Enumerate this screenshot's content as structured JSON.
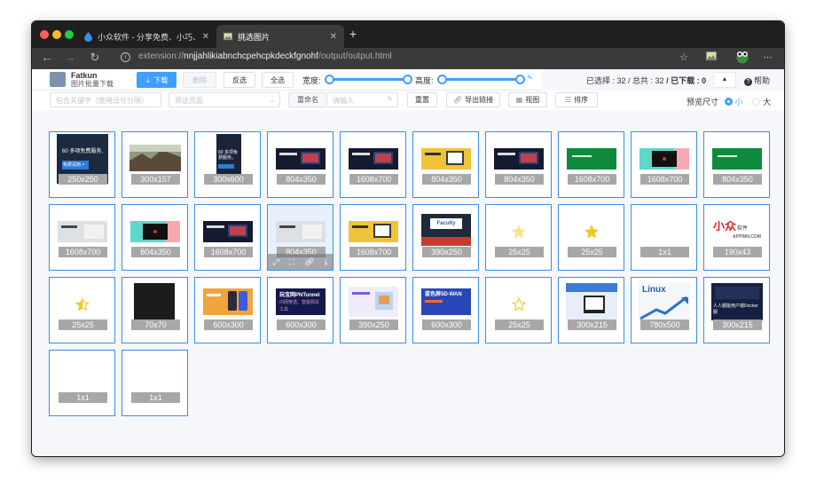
{
  "browser": {
    "tabs": [
      {
        "title": "小众软件 - 分享免费、小巧、实用",
        "favicon": "drop-icon",
        "active": false
      },
      {
        "title": "挑选图片",
        "favicon": "image-icon",
        "active": true
      }
    ],
    "url_prefix": "extension://",
    "url_host": "nnjjahlikiabnchcpehcpkdeckfgnohf",
    "url_path": "/output/output.html"
  },
  "app": {
    "brand_title": "Fatkun",
    "brand_subtitle": "图片批量下载",
    "download_label": "下载",
    "clear_label": "删除",
    "invert_label": "反选",
    "select_all_label": "全选",
    "width_label": "宽度:",
    "height_label": "高度:",
    "width_range_fraction": [
      0.0,
      1.0
    ],
    "height_range_fraction": [
      0.0,
      1.0
    ],
    "selected_label": "已选择 : ",
    "selected_count": "32",
    "total_label": " / 总共 : ",
    "total_count": "32",
    "downloaded_label": " / 已下载 : ",
    "downloaded_count": "0",
    "help_label": "帮助"
  },
  "filters": {
    "keyword_placeholder": "包含关键字（使用逗号分隔）",
    "page_select_placeholder": "筛选页面",
    "rename_label": "重命名",
    "rename_placeholder": "请输入",
    "reset_label": "重置",
    "export_label": "导出链接",
    "view_label": "视图",
    "sort_label": "排序",
    "preview_label": "预览尺寸",
    "size_small": "小",
    "size_large": "大"
  },
  "images": [
    {
      "dim": "250x250",
      "kind": "ad-dark"
    },
    {
      "dim": "300x157",
      "kind": "photo"
    },
    {
      "dim": "300x600",
      "kind": "ad-tall"
    },
    {
      "dim": "804x350",
      "kind": "banner-dark"
    },
    {
      "dim": "1608x700",
      "kind": "banner-dark"
    },
    {
      "dim": "804x350",
      "kind": "banner-yellow"
    },
    {
      "dim": "804x350",
      "kind": "banner-dark"
    },
    {
      "dim": "1608x700",
      "kind": "banner-green"
    },
    {
      "dim": "1608x700",
      "kind": "banner-teal"
    },
    {
      "dim": "804x350",
      "kind": "banner-green"
    },
    {
      "dim": "1608x700",
      "kind": "banner-light"
    },
    {
      "dim": "804x350",
      "kind": "banner-teal"
    },
    {
      "dim": "1608x700",
      "kind": "banner-dark"
    },
    {
      "dim": "804x350",
      "kind": "banner-light",
      "hover": true
    },
    {
      "dim": "1608x700",
      "kind": "banner-yellow"
    },
    {
      "dim": "390x250",
      "kind": "ad-faculty"
    },
    {
      "dim": "25x25",
      "kind": "star-pale"
    },
    {
      "dim": "25x25",
      "kind": "star-gold"
    },
    {
      "dim": "1x1",
      "kind": "blank"
    },
    {
      "dim": "190x43",
      "kind": "logo"
    },
    {
      "dim": "25x25",
      "kind": "star-half"
    },
    {
      "dim": "70x70",
      "kind": "black-square"
    },
    {
      "dim": "600x300",
      "kind": "banner-orange"
    },
    {
      "dim": "600x300",
      "kind": "banner-navy"
    },
    {
      "dim": "390x250",
      "kind": "banner-pastel"
    },
    {
      "dim": "600x300",
      "kind": "banner-blue"
    },
    {
      "dim": "25x25",
      "kind": "star-outline"
    },
    {
      "dim": "300x215",
      "kind": "ad-blue"
    },
    {
      "dim": "780x500",
      "kind": "ad-linux"
    },
    {
      "dim": "300x215",
      "kind": "ad-docker"
    },
    {
      "dim": "1x1",
      "kind": "blank"
    },
    {
      "dim": "1x1",
      "kind": "blank"
    }
  ],
  "thumb_texts": {
    "ad_dark_line": "60 多项免费服务,",
    "ad_dark_button": "免费试用 >",
    "faculty": "Faculty",
    "logo_main": "小众",
    "logo_sub": "软件",
    "logo_url": "APPINN.COM",
    "navy_title": "玩宝网PNTunnel",
    "navy_sub": "内网穿透、智能网关工具",
    "blue_title": "蓝色屏5D-WAN",
    "linux": "Linux",
    "docker": "人人都能用户端Docker 服"
  },
  "colors": {
    "accent": "#409eff",
    "border": "#3a8ee6",
    "dim_badge": "#a7a7a7"
  }
}
